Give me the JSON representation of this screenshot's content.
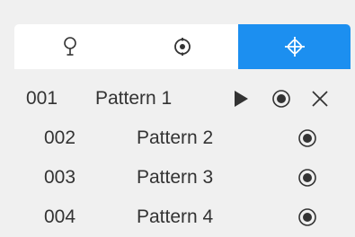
{
  "tabs": [
    {
      "icon": "location-pin-icon",
      "active": false
    },
    {
      "icon": "target-icon",
      "active": false
    },
    {
      "icon": "crosshair-diamond-icon",
      "active": true
    }
  ],
  "accent_color": "#1c8ff0",
  "patterns": [
    {
      "number": "001",
      "name": "Pattern 1",
      "selected": true
    },
    {
      "number": "002",
      "name": "Pattern 2",
      "selected": false
    },
    {
      "number": "003",
      "name": "Pattern 3",
      "selected": false
    },
    {
      "number": "004",
      "name": "Pattern 4",
      "selected": false
    }
  ],
  "row_icons": {
    "play": "play-icon",
    "record": "record-icon",
    "close": "close-icon"
  }
}
